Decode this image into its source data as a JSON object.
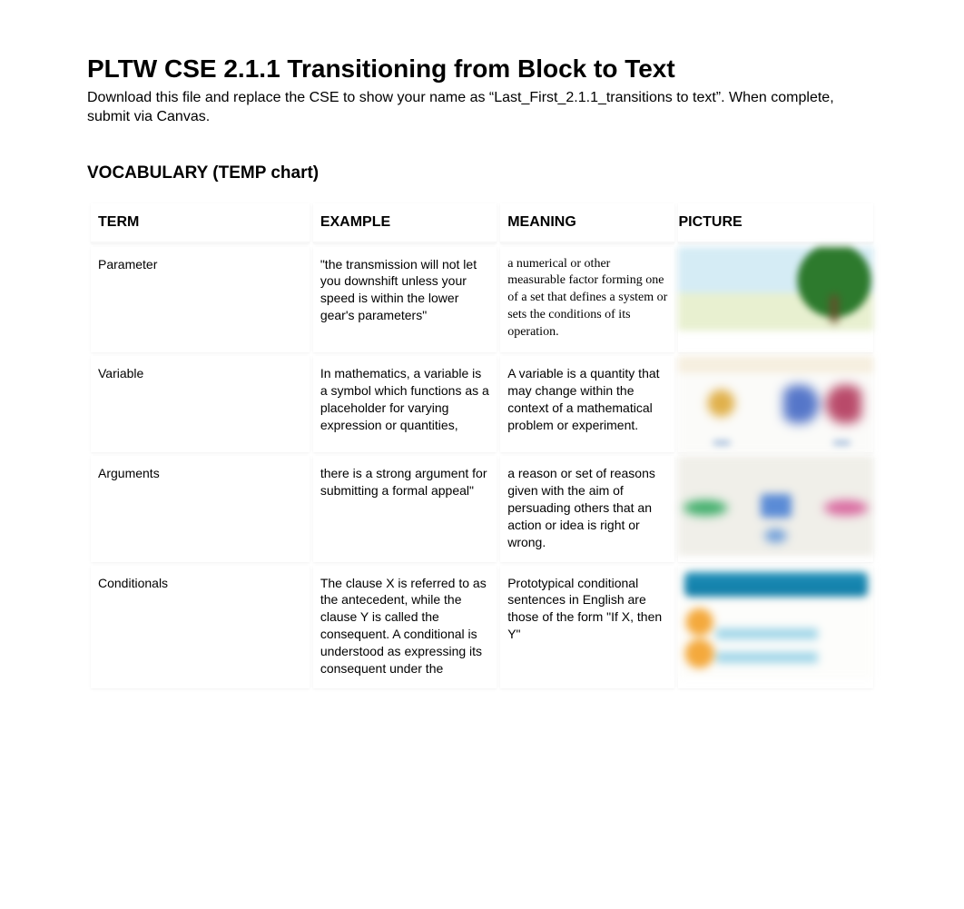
{
  "title": "PLTW CSE 2.1.1 Transitioning from Block to Text",
  "subtitle": "Download this file and replace the CSE to show your name as “Last_First_2.1.1_transitions to text”. When complete, submit via Canvas.",
  "vocab_heading": "VOCABULARY (TEMP chart)",
  "headers": {
    "term": "TERM",
    "example": "EXAMPLE",
    "meaning": "MEANING",
    "picture": "PICTURE"
  },
  "rows": [
    {
      "term": "Parameter",
      "example": "\"the transmission will not let you downshift unless your speed is within the lower gear's parameters\"",
      "meaning": "a numerical or other measurable factor forming one of a set that defines a system or sets the conditions of its operation.",
      "picture_alt": "tree-landscape-icon"
    },
    {
      "term": "Variable",
      "example": "In mathematics, a variable is a symbol which functions as a placeholder for varying expression or quantities,",
      "meaning": "A variable is a quantity that may change within the context of a mathematical problem or experiment.",
      "picture_alt": "categorical-vs-indicator-icon"
    },
    {
      "term": "Arguments",
      "example": "there is a strong argument for submitting a formal appeal\"",
      "meaning": "a reason or set of reasons given with the aim of persuading others that an action or idea is right or wrong.",
      "picture_alt": "argument-map-icon"
    },
    {
      "term": "Conditionals",
      "example": "The clause X is referred to as the antecedent, while the clause Y is called the consequent. A conditional is understood as expressing its consequent under the",
      "meaning": "Prototypical conditional sentences in English are those of the form \"If X, then Y\"",
      "picture_alt": "if-then-flow-icon"
    }
  ]
}
